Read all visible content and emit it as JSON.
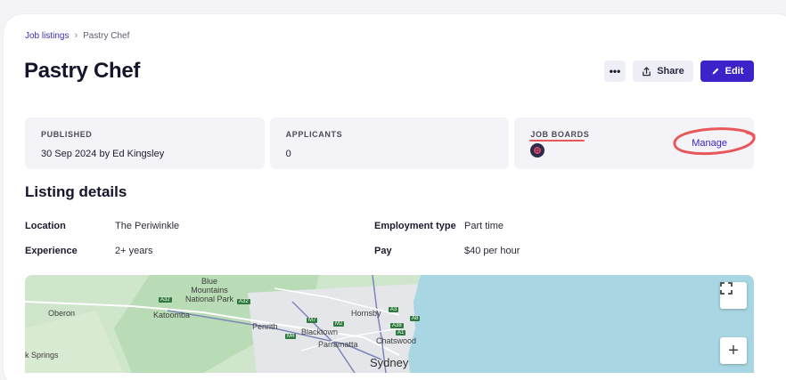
{
  "breadcrumb": {
    "parent": "Job listings",
    "separator": "›",
    "current": "Pastry Chef"
  },
  "page": {
    "title": "Pastry Chef"
  },
  "actions": {
    "more": "•••",
    "share": "Share",
    "edit": "Edit"
  },
  "stats": {
    "published": {
      "label": "PUBLISHED",
      "value": "30 Sep 2024 by Ed Kingsley"
    },
    "applicants": {
      "label": "APPLICANTS",
      "value": "0"
    },
    "job_boards": {
      "label": "JOB BOARDS",
      "manage": "Manage"
    }
  },
  "details": {
    "title": "Listing details",
    "location": {
      "label": "Location",
      "value": "The Periwinkle"
    },
    "experience": {
      "label": "Experience",
      "value": "2+ years"
    },
    "employment_type": {
      "label": "Employment type",
      "value": "Part time"
    },
    "pay": {
      "label": "Pay",
      "value": "$40 per hour"
    }
  },
  "map": {
    "labels": {
      "blue_mountains": "Blue\nMountains\nNational Park",
      "oberon": "Oberon",
      "katoomba": "Katoomba",
      "penrith": "Penrith",
      "blacktown": "Blacktown",
      "hornsby": "Hornsby",
      "chatswood": "Chatswood",
      "parramatta": "Parramatta",
      "sydney": "Sydney",
      "springs": "k Springs"
    },
    "signs": {
      "a32a": "A32",
      "a32b": "A32",
      "m7": "M7",
      "m2": "M2",
      "m4": "M4",
      "a3": "A3",
      "a8": "A8",
      "a38": "A38",
      "a1": "A1"
    },
    "controls": {
      "zoom_in": "+"
    }
  },
  "colors": {
    "accent": "#3b22c9",
    "annotation": "#e8575a",
    "water": "#a8d7e3",
    "land": "#cfe6cc"
  }
}
